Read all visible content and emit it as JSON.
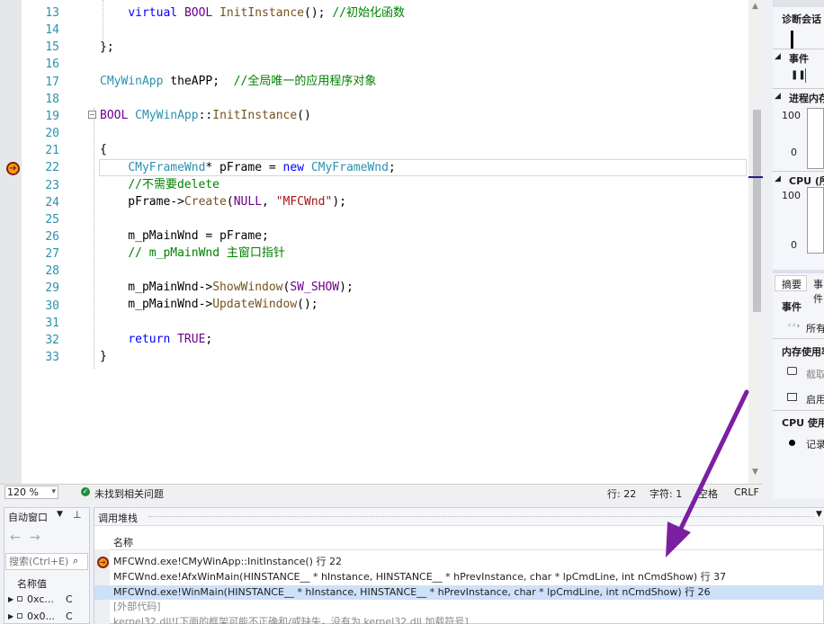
{
  "editor": {
    "line_numbers": [
      "13",
      "14",
      "15",
      "16",
      "17",
      "18",
      "19",
      "20",
      "21",
      "22",
      "23",
      "24",
      "25",
      "26",
      "27",
      "28",
      "29",
      "30",
      "31",
      "32",
      "33"
    ]
  },
  "status_bar": {
    "zoom": "120 %",
    "issues": "未找到相关问题",
    "line": "行: 22",
    "char": "字符: 1",
    "spaces": "空格",
    "eol": "CRLF"
  },
  "diagnostics": {
    "title": "诊断会话",
    "events": "事件",
    "process_memory": "进程内存",
    "mem_top": "100",
    "mem_bottom": "0",
    "cpu": "CPU (所有处理器)",
    "cpu_top": "100",
    "cpu_bottom": "0",
    "tab_summary": "摘要",
    "tab_events": "事件",
    "sec_events": "事件",
    "show_all": "所有事件",
    "sec_memory": "内存使用率",
    "snapshot": "截取快照",
    "enable": "启用堆分析",
    "sec_cpu": "CPU 使用率",
    "record": "记录 CPU 配置文件"
  },
  "autos": {
    "title": "自动窗口",
    "search_placeholder": "搜索(Ctrl+E)",
    "col_name": "名称",
    "col_value": "值",
    "rows": [
      [
        "0xc...",
        "C"
      ],
      [
        "0x0...",
        "C"
      ]
    ]
  },
  "callstack": {
    "title": "调用堆栈",
    "col_name": "名称",
    "frames": [
      "MFCWnd.exe!CMyWinApp::InitInstance() 行 22",
      "MFCWnd.exe!AfxWinMain(HINSTANCE__ * hInstance, HINSTANCE__ * hPrevInstance, char * lpCmdLine, int nCmdShow) 行 37",
      "MFCWnd.exe!WinMain(HINSTANCE__ * hInstance, HINSTANCE__ * hPrevInstance, char * lpCmdLine, int nCmdShow) 行 26",
      "[外部代码]",
      "kernel32.dll![下面的框架可能不正确和/或缺失，没有为 kernel32.dll 加载符号]"
    ]
  },
  "colors": {
    "accent": "#7b1fa2",
    "keyword": "#0000ff",
    "type": "#2b91af",
    "comment": "#008000"
  }
}
